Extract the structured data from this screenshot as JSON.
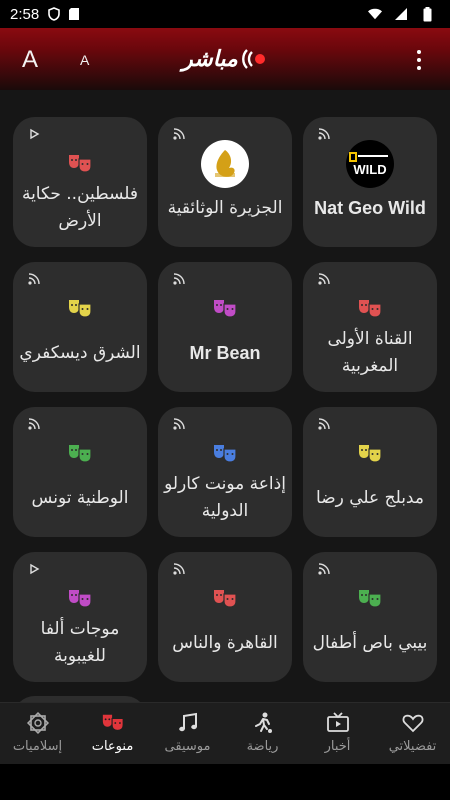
{
  "status": {
    "time": "2:58"
  },
  "appbar": {
    "font_large": "A",
    "font_small": "A",
    "logo_text": "مباشر"
  },
  "cards": [
    {
      "title": "Nat Geo Wild",
      "icon": "nat-geo-wild-logo",
      "indicator": "broadcast",
      "ltr": true
    },
    {
      "title": "الجزيرة الوثائقية",
      "icon": "al-jazeera-documentary-logo",
      "indicator": "broadcast"
    },
    {
      "title": "فلسطين.. حكاية الأرض",
      "icon": "theater-masks-icon",
      "icon_color": "#e05252",
      "indicator": "play"
    },
    {
      "title": "القناة الأولى المغربية",
      "icon": "theater-masks-icon",
      "icon_color": "#e05252",
      "indicator": "broadcast"
    },
    {
      "title": "Mr Bean",
      "icon": "theater-masks-icon",
      "icon_color": "#c04cc6",
      "indicator": "broadcast",
      "ltr": true
    },
    {
      "title": "الشرق ديسكفري",
      "icon": "theater-masks-icon",
      "icon_color": "#e3d34a",
      "indicator": "broadcast"
    },
    {
      "title": "مدبلج علي رضا",
      "icon": "theater-masks-icon",
      "icon_color": "#e3d34a",
      "indicator": "broadcast"
    },
    {
      "title": "إذاعة مونت كارلو الدولية",
      "icon": "theater-masks-icon",
      "icon_color": "#4a7ee0",
      "indicator": "broadcast"
    },
    {
      "title": "الوطنية تونس",
      "icon": "theater-masks-icon",
      "icon_color": "#4caf50",
      "indicator": "broadcast"
    },
    {
      "title": "بيبي باص أطفال",
      "icon": "theater-masks-icon",
      "icon_color": "#4caf50",
      "indicator": "broadcast"
    },
    {
      "title": "القاهرة والناس",
      "icon": "theater-masks-icon",
      "icon_color": "#e05252",
      "indicator": "broadcast"
    },
    {
      "title": "موجات ألفا للغيبوبة",
      "icon": "theater-masks-icon",
      "icon_color": "#c04cc6",
      "indicator": "play"
    }
  ],
  "nav": [
    {
      "label": "تفضيلاتي",
      "icon": "heart-icon"
    },
    {
      "label": "أخبار",
      "icon": "tv-icon"
    },
    {
      "label": "رياضة",
      "icon": "soccer-player-icon"
    },
    {
      "label": "موسيقى",
      "icon": "music-note-icon"
    },
    {
      "label": "منوعات",
      "icon": "theater-masks-icon",
      "active": true
    },
    {
      "label": "إسلاميات",
      "icon": "islamic-star-icon"
    }
  ],
  "colors": {
    "accent": "#e0353b",
    "card_bg": "#2d2d2d",
    "page_bg": "#161616"
  }
}
